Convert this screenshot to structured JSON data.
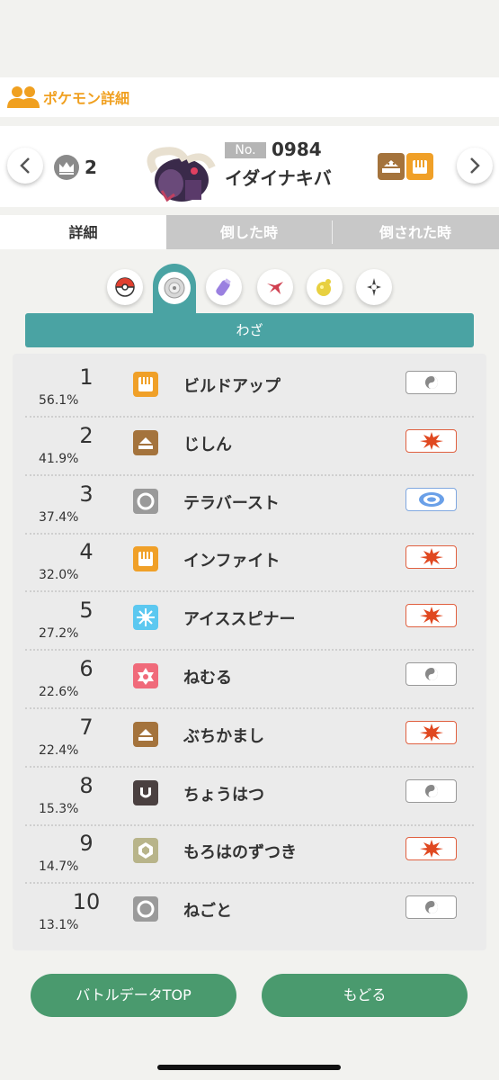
{
  "header": {
    "title": "ポケモン詳細",
    "icon": "people-icon",
    "accent": "#f0a020"
  },
  "pokemon": {
    "rank": "2",
    "dex_label": "No.",
    "dex_number": "0984",
    "name": "イダイナキバ",
    "types": [
      "ground",
      "fighting"
    ]
  },
  "tabs": [
    {
      "label": "詳細",
      "active": true
    },
    {
      "label": "倒した時",
      "active": false
    },
    {
      "label": "倒された時",
      "active": false
    }
  ],
  "categories": [
    "pokeball-icon",
    "disc-icon",
    "item-icon",
    "berry-icon",
    "ability-icon",
    "nature-icon"
  ],
  "active_category": "disc-icon",
  "section": {
    "title": "わざ"
  },
  "moves": [
    {
      "rank": "1",
      "pct": "56.1%",
      "name": "ビルドアップ",
      "type": "fighting",
      "class": "status"
    },
    {
      "rank": "2",
      "pct": "41.9%",
      "name": "じしん",
      "type": "ground",
      "class": "physical"
    },
    {
      "rank": "3",
      "pct": "37.4%",
      "name": "テラバースト",
      "type": "normal",
      "class": "special"
    },
    {
      "rank": "4",
      "pct": "32.0%",
      "name": "インファイト",
      "type": "fighting",
      "class": "physical"
    },
    {
      "rank": "5",
      "pct": "27.2%",
      "name": "アイススピナー",
      "type": "ice",
      "class": "physical"
    },
    {
      "rank": "6",
      "pct": "22.6%",
      "name": "ねむる",
      "type": "psychic",
      "class": "status"
    },
    {
      "rank": "7",
      "pct": "22.4%",
      "name": "ぶちかまし",
      "type": "ground",
      "class": "physical"
    },
    {
      "rank": "8",
      "pct": "15.3%",
      "name": "ちょうはつ",
      "type": "dark",
      "class": "status"
    },
    {
      "rank": "9",
      "pct": "14.7%",
      "name": "もろはのずつき",
      "type": "rock",
      "class": "physical"
    },
    {
      "rank": "10",
      "pct": "13.1%",
      "name": "ねごと",
      "type": "normal",
      "class": "status"
    }
  ],
  "type_colors": {
    "fighting": "#f0a028",
    "ground": "#a4733c",
    "normal": "#9a9a9a",
    "ice": "#5cc8f0",
    "psychic": "#f06a7a",
    "dark": "#4a4040",
    "rock": "#b8b48a"
  },
  "buttons": {
    "top": "バトルデータTOP",
    "back": "もどる"
  }
}
